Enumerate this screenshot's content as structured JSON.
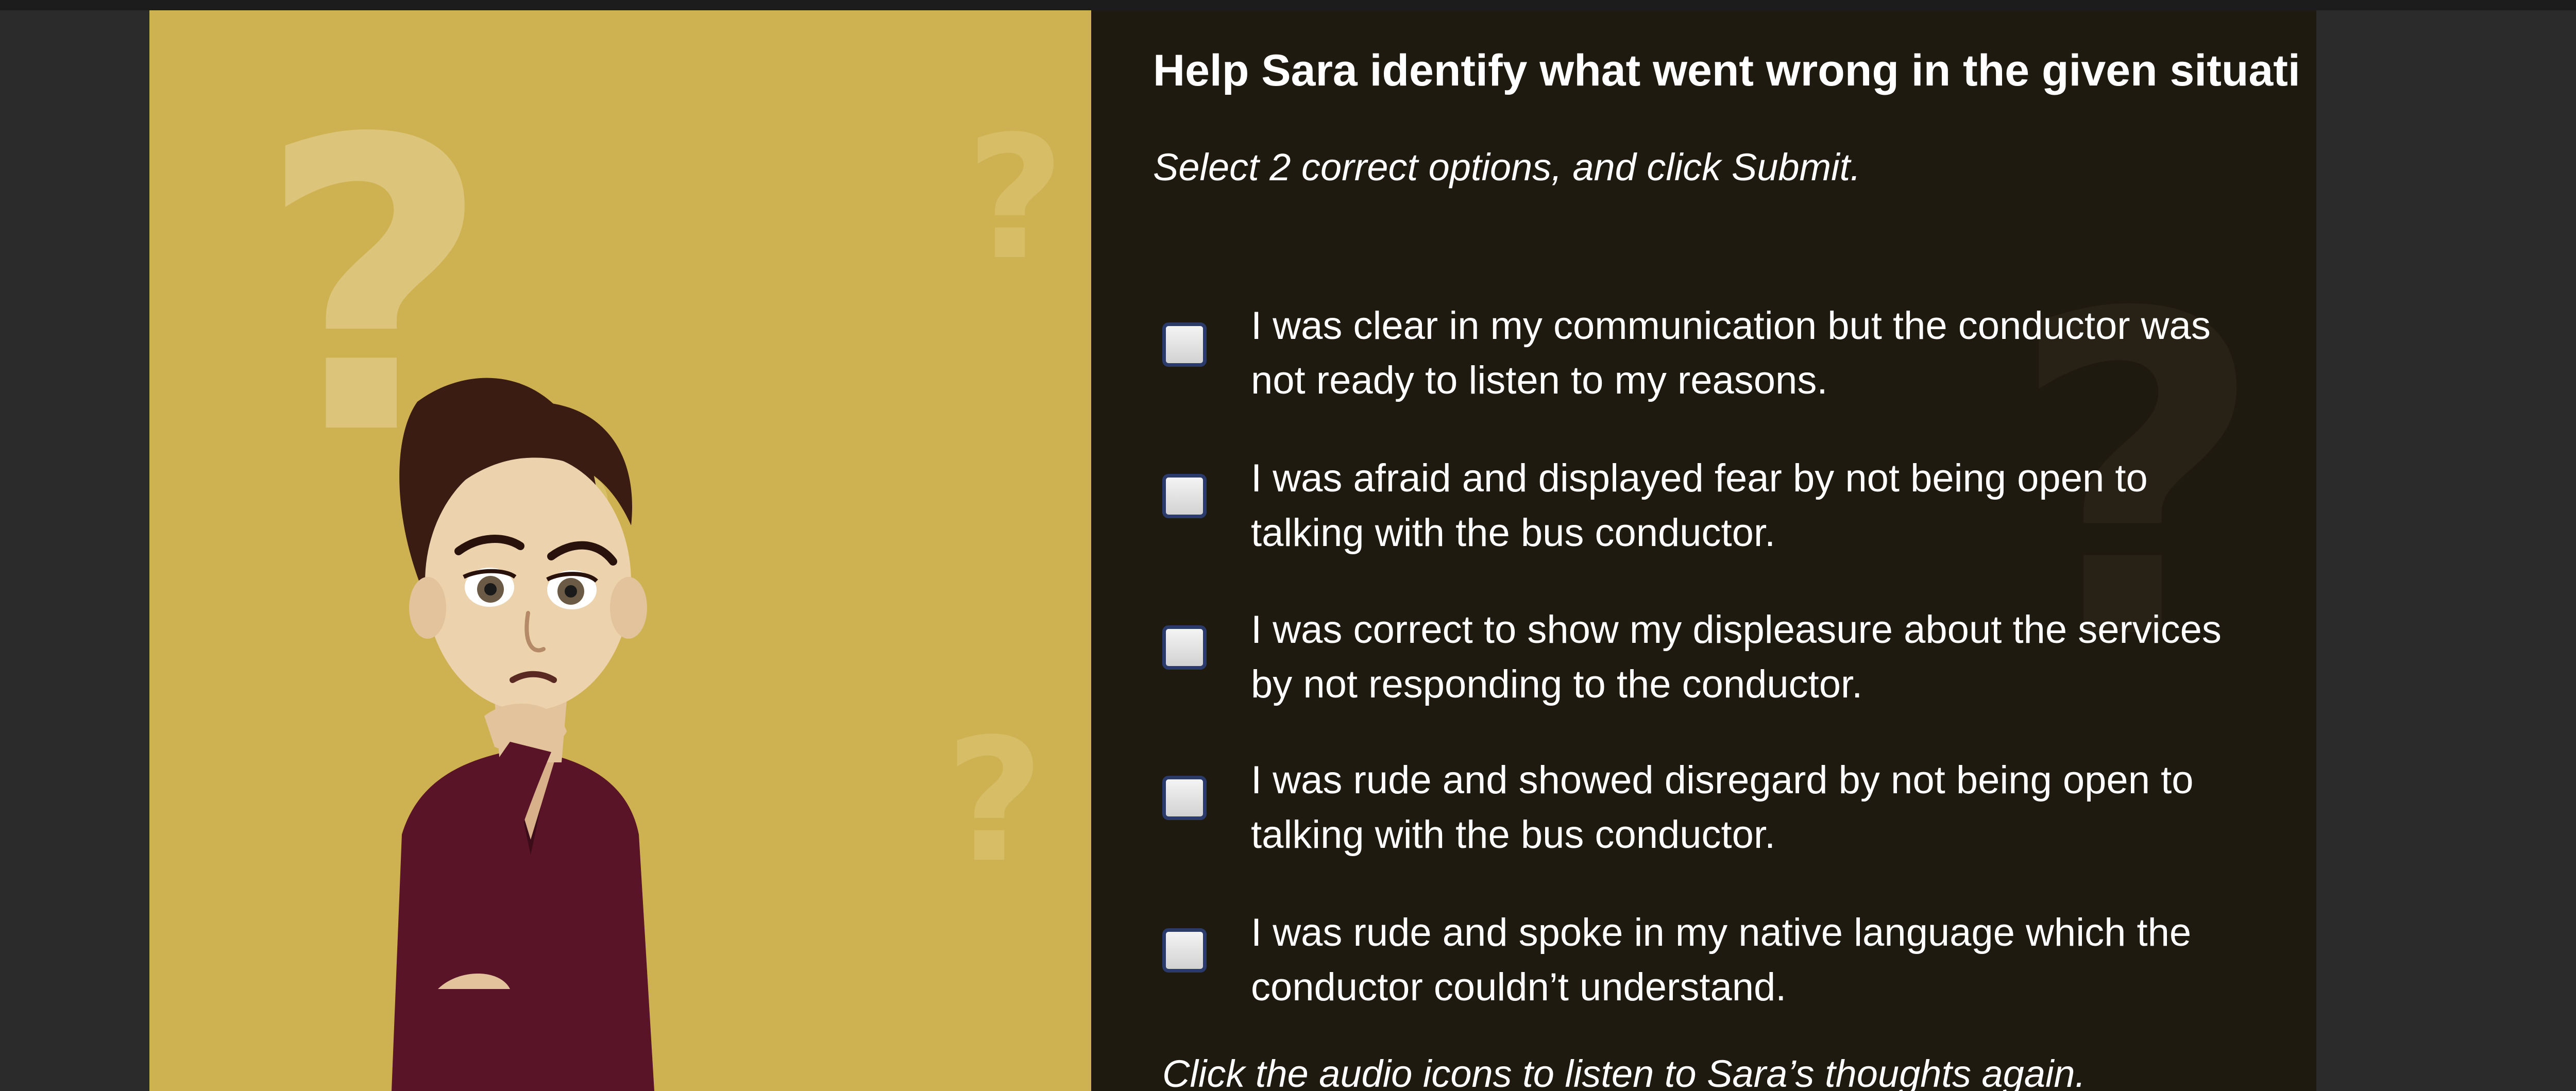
{
  "question": {
    "title": "Help Sara identify what went wrong in the given situati",
    "instruction": "Select 2 correct options, and click Submit."
  },
  "options": [
    {
      "line1": "I was clear in my communication but the conductor was",
      "line2": "not ready to listen to my reasons.",
      "checked": false
    },
    {
      "line1": "I was afraid and displayed fear by not being open to",
      "line2": "talking with the bus conductor.",
      "checked": false
    },
    {
      "line1": "I was correct to show my displeasure about the services",
      "line2": "by not responding to the conductor.",
      "checked": false
    },
    {
      "line1": "I was rude and showed disregard by not being open to",
      "line2": "talking with the bus conductor.",
      "checked": false
    },
    {
      "line1": "I was rude and spoke in my native language which the",
      "line2": "conductor couldn’t understand.",
      "checked": false
    }
  ],
  "footer": {
    "audio_hint": "Click the audio icons to listen to Sara’s thoughts again."
  },
  "decor": {
    "question_mark": "?",
    "icons": [
      "question-mark-decoration",
      "sara-character-illustration",
      "checkbox"
    ]
  },
  "colors": {
    "left_background": "#ceb251",
    "right_background": "#1f1a10",
    "text": "#ffffff",
    "checkbox_border": "#2a3a6a"
  }
}
